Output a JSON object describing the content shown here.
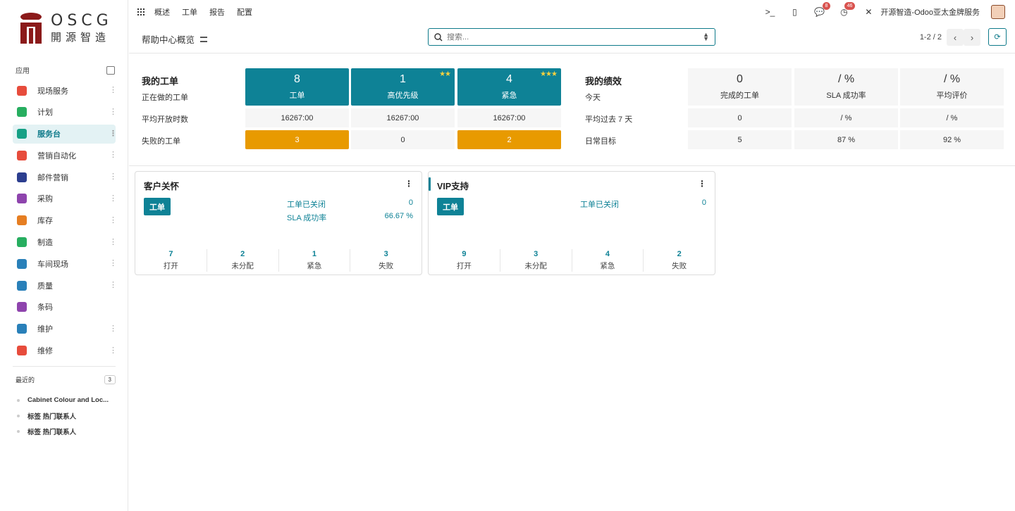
{
  "brand": {
    "en": "OSCG",
    "cn": "開源智造"
  },
  "sidebar": {
    "apps_label": "应用",
    "items": [
      {
        "label": "现场服务",
        "icon": "lightning-icon",
        "color": "#e74c3c"
      },
      {
        "label": "计划",
        "icon": "planning-icon",
        "color": "#27ae60"
      },
      {
        "label": "服务台",
        "icon": "helpdesk-icon",
        "color": "#16a085",
        "active": true
      },
      {
        "label": "营销自动化",
        "icon": "marketing-automation-icon",
        "color": "#e74c3c"
      },
      {
        "label": "邮件营销",
        "icon": "email-marketing-icon",
        "color": "#2c3e8f"
      },
      {
        "label": "采购",
        "icon": "purchase-icon",
        "color": "#8e44ad"
      },
      {
        "label": "库存",
        "icon": "inventory-icon",
        "color": "#e67e22"
      },
      {
        "label": "制造",
        "icon": "manufacturing-icon",
        "color": "#27ae60"
      },
      {
        "label": "车间现场",
        "icon": "shop-floor-icon",
        "color": "#2980b9"
      },
      {
        "label": "质量",
        "icon": "quality-icon",
        "color": "#2980b9"
      },
      {
        "label": "条码",
        "icon": "barcode-icon",
        "color": "#8e44ad"
      },
      {
        "label": "维护",
        "icon": "maintenance-icon",
        "color": "#2980b9"
      },
      {
        "label": "维修",
        "icon": "repair-icon",
        "color": "#e74c3c"
      }
    ],
    "recent_label": "最近的",
    "recent_count": "3",
    "recent_items": [
      "Cabinet Colour and Loc...",
      "标签 热门联系人",
      "标签 热门联系人"
    ]
  },
  "topbar": {
    "menu": [
      "概述",
      "工单",
      "报告",
      "配置"
    ],
    "messages_badge": "8",
    "activities_badge": "46",
    "company": "开源智造-Odoo亚太金牌服务"
  },
  "control": {
    "title": "帮助中心概览",
    "search_placeholder": "搜索...",
    "pager": "1-2 / 2"
  },
  "my_tickets": {
    "title": "我的工单",
    "row_labels": [
      "正在做的工单",
      "平均开放时数",
      "失败的工单"
    ],
    "columns": [
      {
        "count": "8",
        "label": "工单",
        "stars": "",
        "avg_hours": "16267:00",
        "failed": "3",
        "failed_warn": true
      },
      {
        "count": "1",
        "label": "高优先级",
        "stars": "★★",
        "avg_hours": "16267:00",
        "failed": "0",
        "failed_warn": false
      },
      {
        "count": "4",
        "label": "紧急",
        "stars": "★★★",
        "avg_hours": "16267:00",
        "failed": "2",
        "failed_warn": true
      }
    ]
  },
  "my_performance": {
    "title": "我的绩效",
    "row_labels": [
      "今天",
      "平均过去 7 天",
      "日常目标"
    ],
    "columns": [
      {
        "today": "0",
        "label": "完成的工单",
        "avg7": "0",
        "target": "5"
      },
      {
        "today": "/ %",
        "label": "SLA 成功率",
        "avg7": "/ %",
        "target": "87 %"
      },
      {
        "today": "/ %",
        "label": "平均评价",
        "avg7": "/ %",
        "target": "92 %"
      }
    ]
  },
  "teams": [
    {
      "name": "客户关怀",
      "button": "工单",
      "kv": [
        {
          "label": "工单已关闭",
          "value": "0"
        },
        {
          "label": "SLA 成功率",
          "value": "66.67 %"
        }
      ],
      "stats": [
        {
          "n": "7",
          "l": "打开"
        },
        {
          "n": "2",
          "l": "未分配"
        },
        {
          "n": "1",
          "l": "紧急"
        },
        {
          "n": "3",
          "l": "失败"
        }
      ]
    },
    {
      "name": "VIP支持",
      "button": "工单",
      "kv": [
        {
          "label": "工单已关闭",
          "value": "0"
        }
      ],
      "stats": [
        {
          "n": "9",
          "l": "打开"
        },
        {
          "n": "3",
          "l": "未分配"
        },
        {
          "n": "4",
          "l": "紧急"
        },
        {
          "n": "2",
          "l": "失败"
        }
      ]
    }
  ],
  "colors": {
    "accent": "#0e8296",
    "warning": "#e89a00",
    "brand_red": "#8b1a1a"
  }
}
